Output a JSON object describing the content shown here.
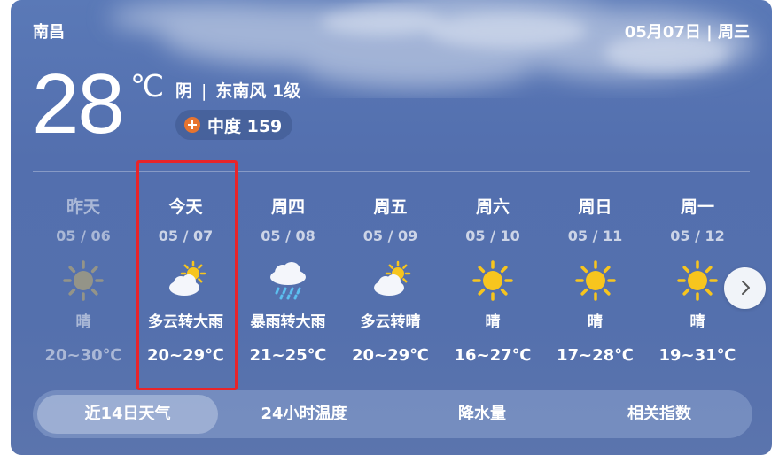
{
  "header": {
    "city": "南昌",
    "date": "05月07日 | 周三"
  },
  "current": {
    "temp": "28",
    "unit": "℃",
    "condition": "阴",
    "separator": "|",
    "wind": "东南风 1级",
    "aqi_label": "中度 159",
    "aqi_color": "#e7742f"
  },
  "days": [
    {
      "name": "昨天",
      "date": "05 / 06",
      "icon": "sun-icon",
      "condition": "晴",
      "range": "20~30℃",
      "past": true
    },
    {
      "name": "今天",
      "date": "05 / 07",
      "icon": "partly-cloudy-icon",
      "condition": "多云转大雨",
      "range": "20~29℃",
      "past": false
    },
    {
      "name": "周四",
      "date": "05 / 08",
      "icon": "rain-cloud-icon",
      "condition": "暴雨转大雨",
      "range": "21~25℃",
      "past": false
    },
    {
      "name": "周五",
      "date": "05 / 09",
      "icon": "partly-cloudy-icon",
      "condition": "多云转晴",
      "range": "20~29℃",
      "past": false
    },
    {
      "name": "周六",
      "date": "05 / 10",
      "icon": "sun-icon",
      "condition": "晴",
      "range": "16~27℃",
      "past": false
    },
    {
      "name": "周日",
      "date": "05 / 11",
      "icon": "sun-icon",
      "condition": "晴",
      "range": "17~28℃",
      "past": false
    },
    {
      "name": "周一",
      "date": "05 / 12",
      "icon": "sun-icon",
      "condition": "晴",
      "range": "19~31℃",
      "past": false
    }
  ],
  "tabs": [
    {
      "label": "近14日天气",
      "active": true
    },
    {
      "label": "24小时温度",
      "active": false
    },
    {
      "label": "降水量",
      "active": false
    },
    {
      "label": "相关指数",
      "active": false
    }
  ],
  "colors": {
    "highlight_border": "#e8242a",
    "sun": "#f7c51e"
  }
}
